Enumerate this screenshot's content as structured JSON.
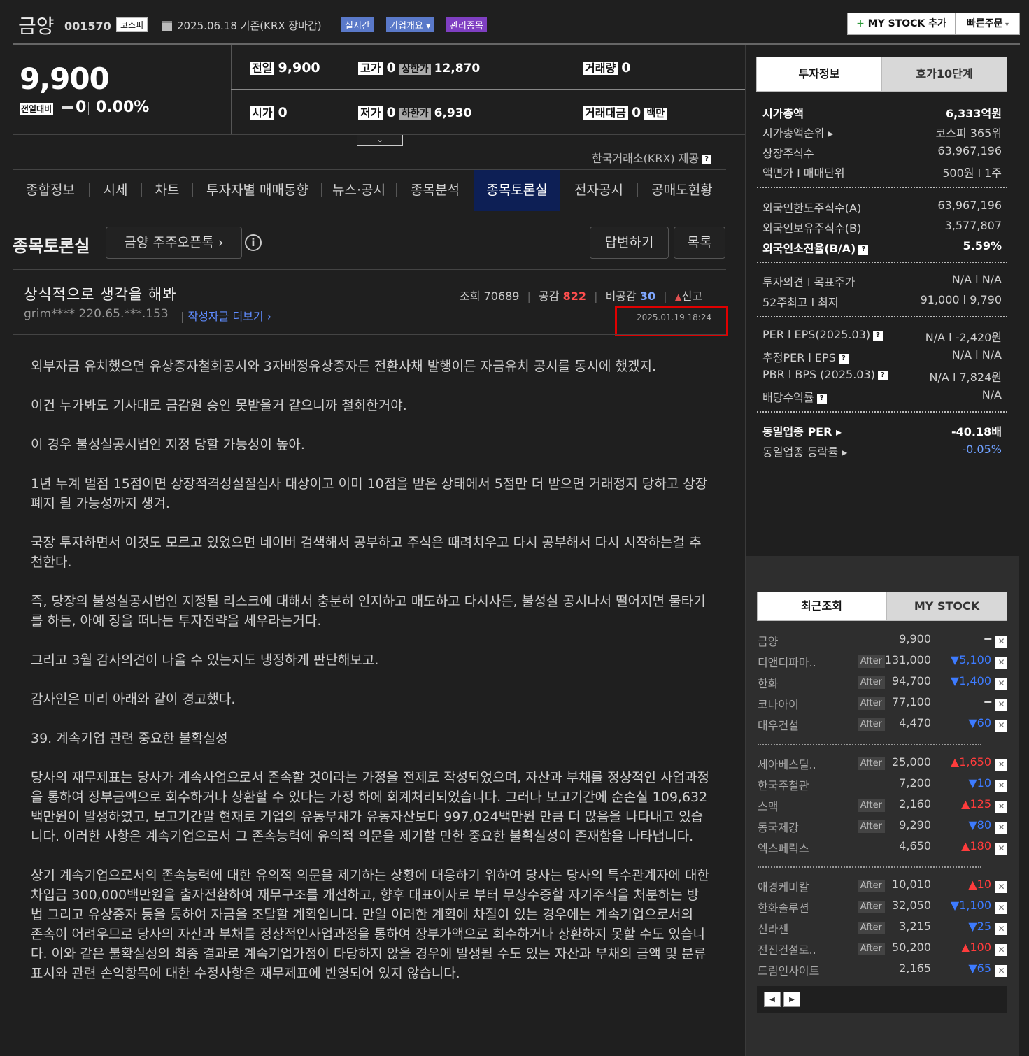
{
  "header": {
    "company": "금양",
    "code": "001570",
    "market": "코스피",
    "base_date": "2025.06.18 기준(KRX 장마감)",
    "badges": [
      "실시간",
      "기업개요",
      "관리종목"
    ],
    "mystock_label": "MY STOCK 추가",
    "quick_order_label": "빠른주문"
  },
  "price": {
    "current": "9,900",
    "prev_label": "전일대비",
    "change": "0",
    "change_pct": "0.00%"
  },
  "quote": {
    "prev_close_label": "전일",
    "prev_close": "9,900",
    "high_label": "고가",
    "high": "0",
    "upper_label": "상한가",
    "upper": "12,870",
    "volume_label": "거래량",
    "volume": "0",
    "open_label": "시가",
    "open": "0",
    "low_label": "저가",
    "low": "0",
    "lower_label": "하한가",
    "lower": "6,930",
    "amount_label": "거래대금",
    "amount": "0",
    "amount_unit": "백만",
    "provider_note": "한국거래소(KRX) 제공"
  },
  "tabs": [
    "종합정보",
    "시세",
    "차트",
    "투자자별 매매동향",
    "뉴스·공시",
    "종목분석",
    "종목토론실",
    "전자공시",
    "공매도현황"
  ],
  "board": {
    "title": "종목토론실",
    "subtitle_button": "금양 주주오픈톡",
    "reply_button": "답변하기",
    "list_button": "목록"
  },
  "post": {
    "title": "상식적으로 생각을 해봐",
    "views_label": "조회",
    "views": "70689",
    "likes_label": "공감",
    "likes": "822",
    "dislikes_label": "비공감",
    "dislikes": "30",
    "report_label": "신고",
    "author": "grim**** 220.65.***.153",
    "more_link": "작성자글 더보기",
    "date": "2025.01.19 18:24",
    "paragraphs": [
      "외부자금 유치했으면 유상증자철회공시와 3자배정유상증자든 전환사채 발행이든 자금유치 공시를 동시에 했겠지.",
      "이건 누가봐도 기사대로 금감원 승인 못받을거 같으니까 철회한거야.",
      "이 경우 불성실공시법인 지정 당할 가능성이 높아.",
      "1년 누계 벌점 15점이면 상장적격성실질심사 대상이고 이미 10점을 받은 상태에서 5점만 더 받으면 거래정지 당하고 상장폐지 될 가능성까지 생겨.",
      "국장 투자하면서 이것도 모르고 있었으면 네이버 검색해서 공부하고 주식은 때려치우고 다시 공부해서 다시 시작하는걸 추천한다.",
      "즉, 당장의 불성실공시법인 지정될 리스크에 대해서 충분히 인지하고 매도하고 다시사든, 불성실 공시나서 떨어지면 물타기를 하든, 아예 장을 떠나든 투자전략을 세우라는거다.",
      "그리고 3월 감사의견이 나올 수 있는지도 냉정하게 판단해보고.",
      "감사인은 미리 아래와 같이 경고했다.",
      "39. 계속기업 관련 중요한 불확실성",
      "당사의 재무제표는 당사가 계속사업으로서 존속할 것이라는 가정을 전제로 작성되었으며, 자산과 부채를 정상적인 사업과정을 통하여 장부금액으로 회수하거나 상환할 수 있다는 가정 하에 회계처리되었습니다. 그러나 보고기간에 순손실 109,632백만원이 발생하였고, 보고기간말 현재로 기업의 유동부채가 유동자산보다 997,024백만원 만큼 더 많음을 나타내고 있습니다. 이러한 사항은 계속기업으로서 그 존속능력에 유의적 의문을 제기할 만한 중요한 불확실성이 존재함을 나타냅니다.",
      "상기 계속기업으로서의 존속능력에 대한 유의적 의문을 제기하는 상황에 대응하기 위하여 당사는 당사의 특수관계자에 대한 차입금 300,000백만원을 출자전환하여 재무구조를 개선하고, 향후 대표이사로 부터 무상수증할 자기주식을 처분하는 방법 그리고 유상증자 등을 통하여 자금을 조달할 계획입니다. 만일 이러한 계획에 차질이 있는 경우에는 계속기업으로서의 존속이 어려우므로 당사의 자산과 부채를 정상적인사업과정을 통하여 장부가액으로 회수하거나 상환하지 못할 수도 있습니다. 이와 같은 불확실성의 최종 결과로 계속기업가정이 타당하지 않을 경우에 발생될 수도 있는 자산과 부채의 금액 및 분류표시와 관련 손익항목에 대한 수정사항은 재무제표에 반영되어 있지 않습니다."
    ]
  },
  "right_tabs": [
    "투자정보",
    "호가10단계"
  ],
  "invest": [
    {
      "label": "시가총액",
      "value": "6,333억원",
      "strong": true
    },
    {
      "label": "시가총액순위 ▸",
      "value": "코스피 365위"
    },
    {
      "label": "상장주식수",
      "value": "63,967,196"
    },
    {
      "label": "액면가 l 매매단위",
      "value": "500원 l 1주"
    },
    {
      "label": "외국인한도주식수(A)",
      "value": "63,967,196"
    },
    {
      "label": "외국인보유주식수(B)",
      "value": "3,577,807"
    },
    {
      "label": "외국인소진율(B/A)",
      "value": "5.59%",
      "strong": true
    },
    {
      "label": "투자의견 l 목표주가",
      "value": "N/A l N/A"
    },
    {
      "label": "52주최고 l 최저",
      "value": "91,000 l 9,790"
    },
    {
      "label": "PER l EPS(2025.03)",
      "value": "N/A l -2,420원"
    },
    {
      "label": "추정PER l EPS",
      "value": "N/A l N/A"
    },
    {
      "label": "PBR l BPS (2025.03)",
      "value": "N/A l 7,824원"
    },
    {
      "label": "배당수익률",
      "value": "N/A"
    },
    {
      "label": "동일업종 PER ▸",
      "value": "-40.18배",
      "strong": true
    },
    {
      "label": "동일업종 등락률 ▸",
      "value": "-0.05%",
      "blue": true
    }
  ],
  "recent_tabs": [
    "최근조회",
    "MY STOCK"
  ],
  "recent": [
    {
      "name": "금양",
      "after": "",
      "price": "9,900",
      "change": "━",
      "dir": "flat"
    },
    {
      "name": "디앤디파마..",
      "after": "After",
      "price": "131,000",
      "change": "▼5,100",
      "dir": "dn"
    },
    {
      "name": "한화",
      "after": "After",
      "price": "94,700",
      "change": "▼1,400",
      "dir": "dn"
    },
    {
      "name": "코나아이",
      "after": "After",
      "price": "77,100",
      "change": "━",
      "dir": "flat"
    },
    {
      "name": "대우건설",
      "after": "After",
      "price": "4,470",
      "change": "▼60",
      "dir": "dn"
    },
    {
      "name": "세아베스틸..",
      "after": "After",
      "price": "25,000",
      "change": "▲1,650",
      "dir": "up"
    },
    {
      "name": "한국주철관",
      "after": "",
      "price": "7,200",
      "change": "▼10",
      "dir": "dn"
    },
    {
      "name": "스맥",
      "after": "After",
      "price": "2,160",
      "change": "▲125",
      "dir": "up"
    },
    {
      "name": "동국제강",
      "after": "After",
      "price": "9,290",
      "change": "▼80",
      "dir": "dn"
    },
    {
      "name": "엑스페릭스",
      "after": "",
      "price": "4,650",
      "change": "▲180",
      "dir": "up"
    },
    {
      "name": "애경케미칼",
      "after": "After",
      "price": "10,010",
      "change": "▲10",
      "dir": "up"
    },
    {
      "name": "한화솔루션",
      "after": "After",
      "price": "32,050",
      "change": "▼1,100",
      "dir": "dn"
    },
    {
      "name": "신라젠",
      "after": "After",
      "price": "3,215",
      "change": "▼25",
      "dir": "dn"
    },
    {
      "name": "전진건설로..",
      "after": "After",
      "price": "50,200",
      "change": "▲100",
      "dir": "up"
    },
    {
      "name": "드림인사이트",
      "after": "",
      "price": "2,165",
      "change": "▼65",
      "dir": "dn"
    }
  ],
  "colors": {
    "up": "#ff3c3c",
    "down": "#3d7bff",
    "active_tab": "#0d1f55",
    "highlight_box": "#e00000"
  }
}
